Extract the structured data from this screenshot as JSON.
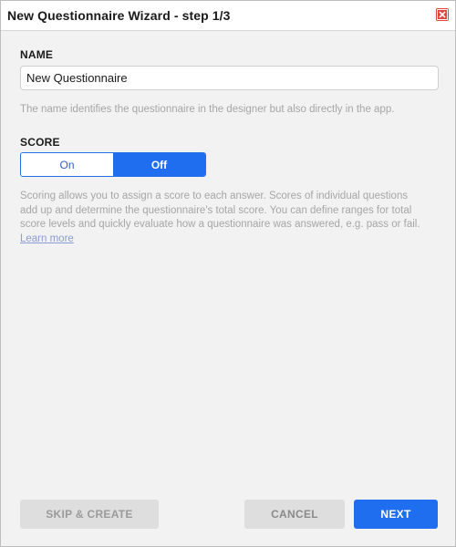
{
  "window": {
    "title": "New Questionnaire Wizard - step 1/3",
    "close_icon": "close-icon"
  },
  "name_section": {
    "label": "NAME",
    "value": "New Questionnaire",
    "help": "The name identifies the questionnaire in the designer but also directly in the app."
  },
  "score_section": {
    "label": "SCORE",
    "options": [
      {
        "label": "On",
        "selected": false
      },
      {
        "label": "Off",
        "selected": true
      }
    ],
    "help": "Scoring allows you to assign a score to each answer. Scores of individual questions add up and determine the questionnaire's total score. You can define ranges for total score levels and quickly evaluate how a questionnaire was answered, e.g. pass or fail.",
    "learn_more": "Learn more"
  },
  "footer": {
    "skip_label": "SKIP & CREATE",
    "cancel_label": "CANCEL",
    "next_label": "NEXT"
  },
  "colors": {
    "accent": "#1f6ef0",
    "close": "#e0463d",
    "help_text": "#a6a6a6",
    "link": "#8a9bd6"
  }
}
